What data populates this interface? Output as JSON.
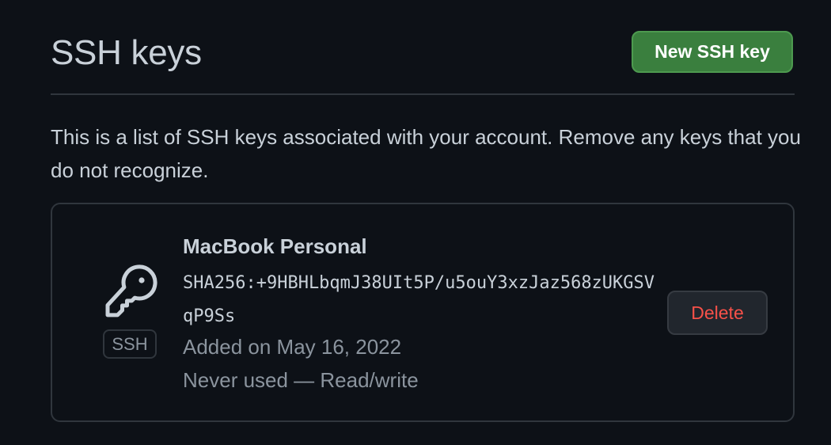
{
  "header": {
    "title": "SSH keys",
    "new_key_button_label": "New SSH key"
  },
  "description": "This is a list of SSH keys associated with your account. Remove any keys that you do not recognize.",
  "keys": [
    {
      "title": "MacBook Personal",
      "icon": "key-icon",
      "badge": "SSH",
      "fingerprint": "SHA256:+9HBHLbqmJ38UIt5P/u5ouY3xzJaz568zUKGSVqP9Ss",
      "added": "Added on May 16, 2022",
      "usage": "Never used — Read/write",
      "delete_label": "Delete"
    }
  ],
  "colors": {
    "background": "#0d1117",
    "primary_button": "#3a7f3e",
    "danger_text": "#f85149",
    "muted_text": "#8b949e",
    "border": "#30363d"
  }
}
